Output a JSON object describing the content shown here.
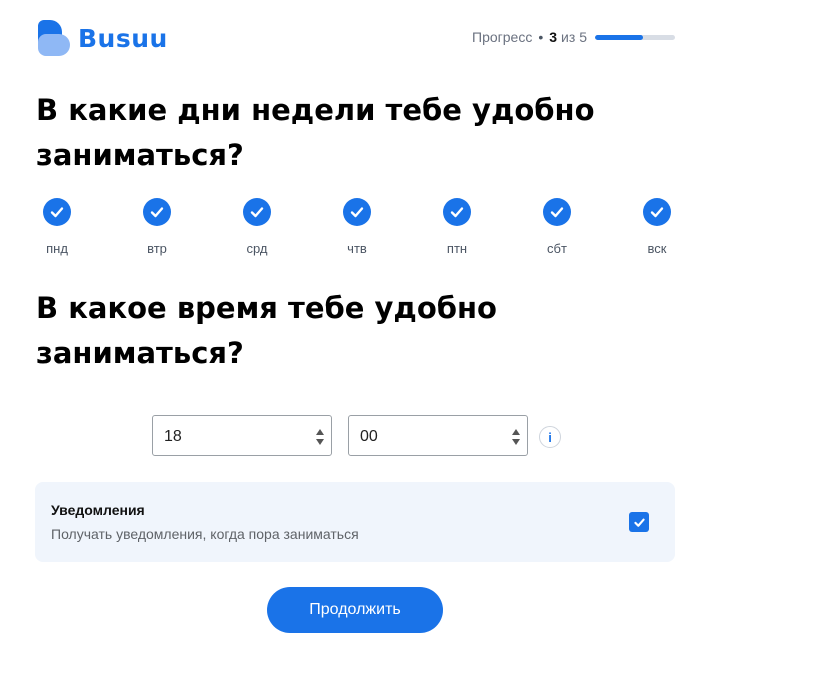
{
  "brand": {
    "name": "Busuu"
  },
  "progress": {
    "label": "Прогресс",
    "separator": "•",
    "current": "3",
    "of": "из",
    "total": "5",
    "fraction": 0.6
  },
  "days_section": {
    "title": "В какие дни недели тебе удобно заниматься?",
    "days": [
      {
        "label": "пнд",
        "checked": true
      },
      {
        "label": "втр",
        "checked": true
      },
      {
        "label": "срд",
        "checked": true
      },
      {
        "label": "чтв",
        "checked": true
      },
      {
        "label": "птн",
        "checked": true
      },
      {
        "label": "сбт",
        "checked": true
      },
      {
        "label": "вск",
        "checked": true
      }
    ]
  },
  "time_section": {
    "title": "В какое время тебе удобно заниматься?",
    "hour": "18",
    "minute": "00",
    "info_icon": "info-icon"
  },
  "notifications": {
    "title": "Уведомления",
    "description": "Получать уведомления, когда пора заниматься",
    "checked": true
  },
  "continue_button": {
    "label": "Продолжить"
  },
  "colors": {
    "accent": "#1a73e8",
    "panel": "#f0f5fc"
  }
}
